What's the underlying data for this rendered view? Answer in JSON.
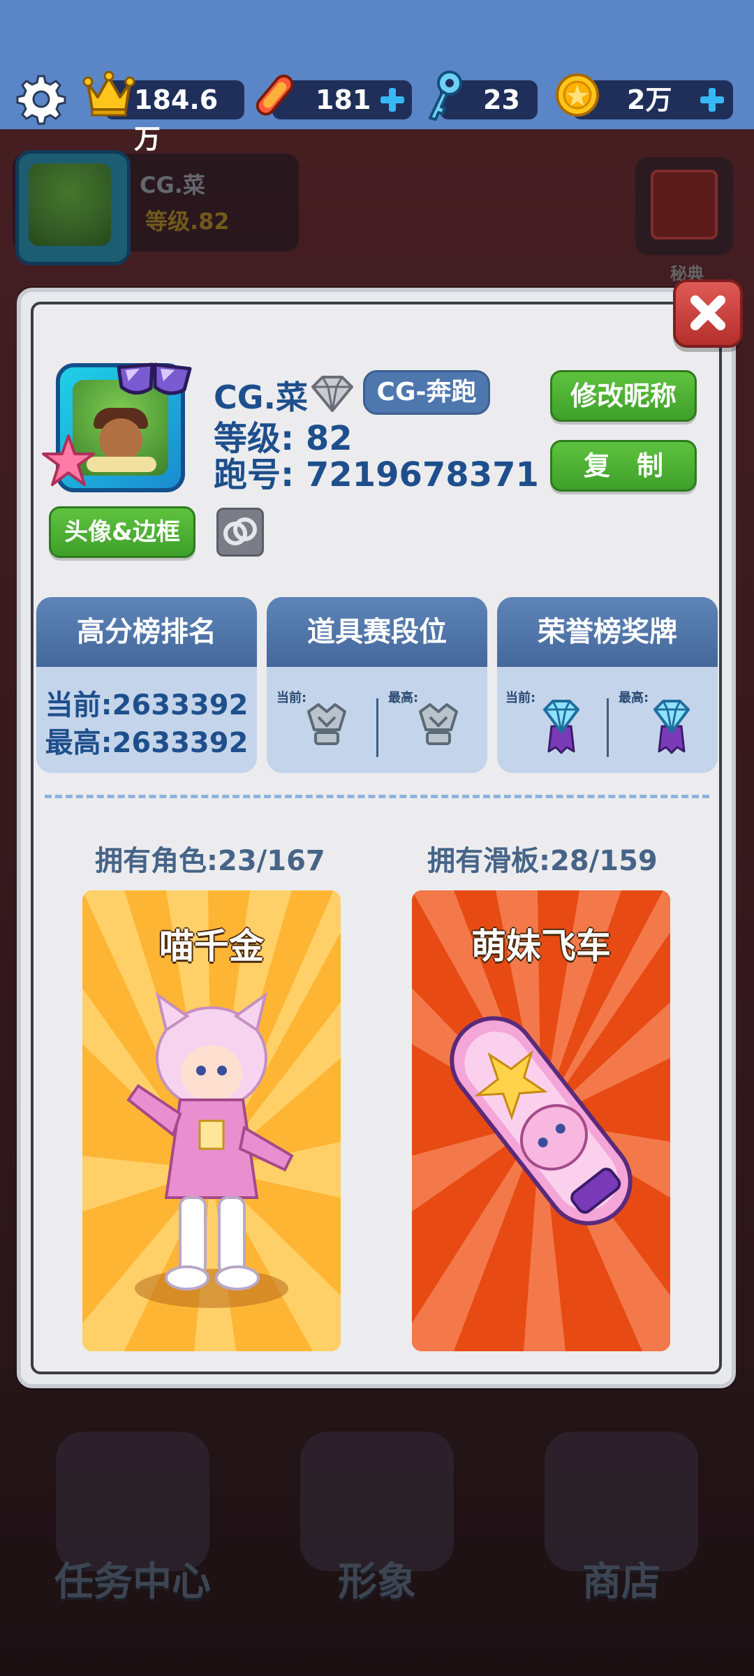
{
  "resources": {
    "trophy_value": "184.6万",
    "skateboards_value": "181",
    "keys_value": "23",
    "coins_value": "2万"
  },
  "background": {
    "player_name": "CG.菜",
    "player_level": "等级.82",
    "book_label": "秘典",
    "bottom_nav": [
      "任务中心",
      "形象",
      "商店"
    ]
  },
  "profile": {
    "name": "CG.菜",
    "crew": "CG-奔跑",
    "level": "等级: 82",
    "run_id": "跑号: 7219678371",
    "rename_button": "修改昵称",
    "copy_button": "复　制",
    "avatar_frame_button": "头像&边框"
  },
  "stats": {
    "high_score": {
      "title": "高分榜排名",
      "current": "当前:2633392",
      "highest": "最高:2633392"
    },
    "prop_rank": {
      "title": "道具赛段位",
      "current_label": "当前:",
      "highest_label": "最高:"
    },
    "honor_medal": {
      "title": "荣誉榜奖牌",
      "current_label": "当前:",
      "highest_label": "最高:"
    }
  },
  "collection": {
    "characters_label": "拥有角色:23/167",
    "boards_label": "拥有滑板:28/159",
    "character_name": "喵千金",
    "board_name": "萌妹飞车"
  },
  "colors": {
    "panel_title_blue": "#1e4f8c",
    "green_button": "#3ea02a",
    "header_blue": "#44689c",
    "close_red": "#b42f2d",
    "character_bg": "#ffb534",
    "board_bg": "#e84a14"
  }
}
